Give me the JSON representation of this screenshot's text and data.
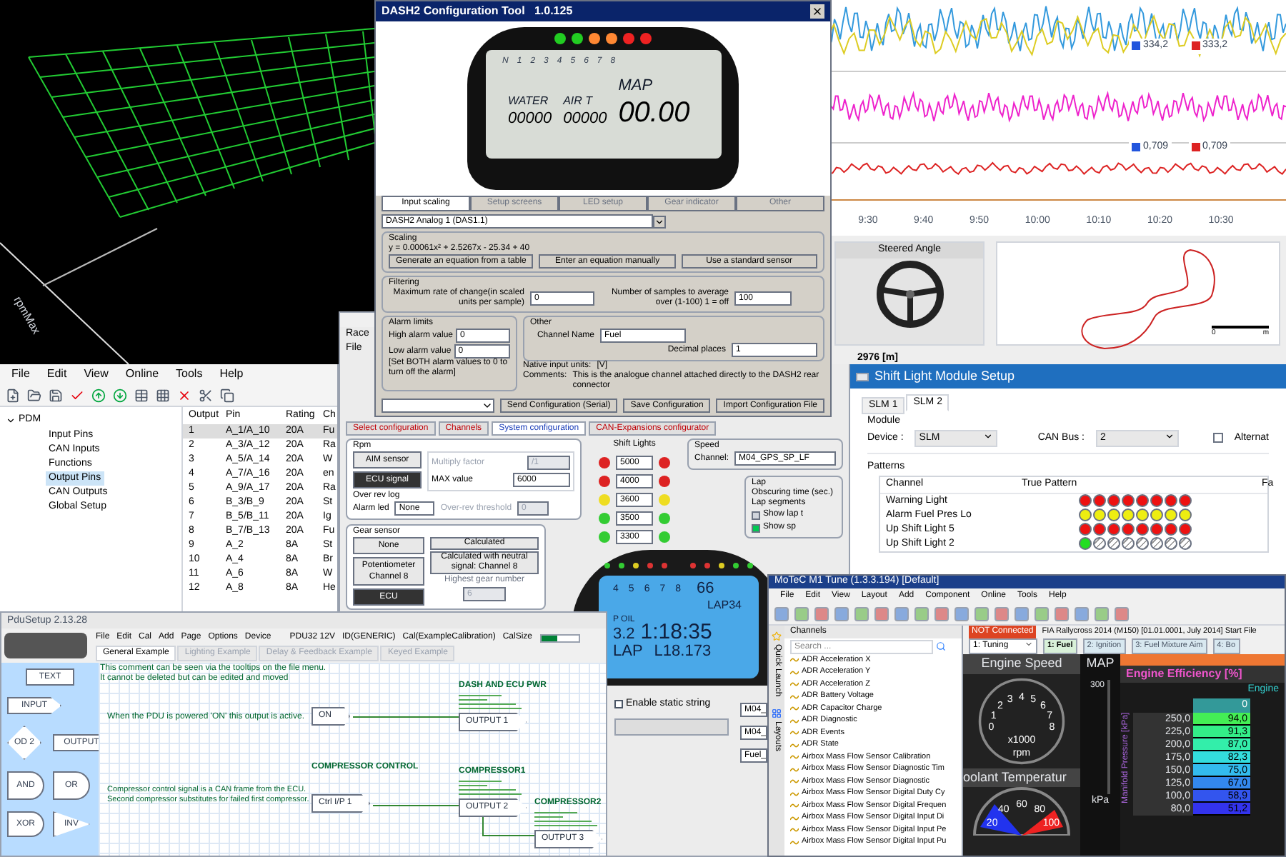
{
  "mesh_view": {
    "axis_label": "rpmMax"
  },
  "time_graph": {
    "markers": [
      {
        "value": "334,2",
        "color": "#2255dd"
      },
      {
        "value": "333,2",
        "color": "#dd2222"
      },
      {
        "value": "0,709",
        "color": "#2255dd"
      },
      {
        "value": "0,709",
        "color": "#dd2222"
      }
    ],
    "time_labels": [
      "9:30",
      "9:40",
      "9:50",
      "10:00",
      "10:10",
      "10:20",
      "10:30"
    ]
  },
  "dash_tool": {
    "title": "DASH2 Configuration Tool   1.0.125",
    "shift_lights": [
      {
        "color": "#22cc22"
      },
      {
        "color": "#22cc22"
      },
      {
        "color": "#ff8833"
      },
      {
        "color": "#ff8833"
      },
      {
        "color": "#ee2222"
      },
      {
        "color": "#ee2222"
      }
    ],
    "display": {
      "rpm_scale": [
        "N",
        "1",
        "2",
        "3",
        "4",
        "5",
        "6",
        "7",
        "8"
      ],
      "fields": [
        {
          "label": "WATER",
          "value": "00000"
        },
        {
          "label": "AIR T",
          "value": "00000"
        },
        {
          "label": "MAP",
          "value": "00.00"
        }
      ]
    },
    "tabs": [
      {
        "label": "Input scaling",
        "selected": true
      },
      {
        "label": "Setup screens",
        "selected": false
      },
      {
        "label": "LED setup",
        "selected": false
      },
      {
        "label": "Gear indicator",
        "selected": false
      },
      {
        "label": "Other",
        "selected": false
      }
    ],
    "channel_select": "DASH2 Analog 1 (DAS1.1)",
    "scaling": {
      "title": "Scaling",
      "equation": "y = 0.00061x² + 2.5267x - 25.34 + 40",
      "buttons": [
        "Generate an equation from a table",
        "Enter an equation manually",
        "Use a standard sensor"
      ]
    },
    "filtering": {
      "title": "Filtering",
      "max_rate_label": "Maximum rate of change(in scaled units per sample)",
      "max_rate": "0",
      "samples_label": "Number of samples to average over (1-100) 1 = off",
      "samples": "100"
    },
    "alarm": {
      "title": "Alarm limits",
      "high_label": "High alarm value",
      "high": "0",
      "low_label": "Low alarm value",
      "low": "0",
      "note": "[Set BOTH alarm values to 0 to turn off the alarm]"
    },
    "other": {
      "title": "Other",
      "name_label": "Channel Name",
      "name": "Fuel",
      "decimals_label": "Decimal places",
      "decimals": "1",
      "units_label": "Native input units:",
      "units": "[V]",
      "comments_label": "Comments:",
      "comments": "This is the analogue channel attached directly to the DASH2 rear connector"
    },
    "footer_buttons": [
      "Send Configuration (Serial)",
      "Save Configuration",
      "Import Configuration File"
    ]
  },
  "steering": {
    "gauge_title": "Steered Angle",
    "scale": [
      "0",
      "m"
    ],
    "distance": "2976 [m]"
  },
  "pdm": {
    "menu": [
      "File",
      "Edit",
      "View",
      "Online",
      "Tools",
      "Help"
    ],
    "tree": {
      "label": "PDM",
      "expanded": true,
      "children": [
        {
          "label": "Input Pins",
          "selected": false
        },
        {
          "label": "CAN Inputs",
          "selected": false
        },
        {
          "label": "Functions",
          "selected": false
        },
        {
          "label": "Output Pins",
          "selected": true
        },
        {
          "label": "CAN Outputs",
          "selected": false
        },
        {
          "label": "Global Setup",
          "selected": false
        }
      ]
    },
    "table": {
      "columns": [
        "Output",
        "Pin",
        "Rating",
        "Ch"
      ],
      "rows": [
        {
          "cells": [
            "1",
            "A_1/A_10",
            "20A",
            "Fu"
          ],
          "selected": true
        },
        {
          "cells": [
            "2",
            "A_3/A_12",
            "20A",
            "Ra"
          ],
          "selected": false
        },
        {
          "cells": [
            "3",
            "A_5/A_14",
            "20A",
            "W"
          ],
          "selected": false
        },
        {
          "cells": [
            "4",
            "A_7/A_16",
            "20A",
            "en"
          ],
          "selected": false
        },
        {
          "cells": [
            "5",
            "A_9/A_17",
            "20A",
            "Ra"
          ],
          "selected": false
        },
        {
          "cells": [
            "6",
            "B_3/B_9",
            "20A",
            "St"
          ],
          "selected": false
        },
        {
          "cells": [
            "7",
            "B_5/B_11",
            "20A",
            "Ig"
          ],
          "selected": false
        },
        {
          "cells": [
            "8",
            "B_7/B_13",
            "20A",
            "Fu"
          ],
          "selected": false
        },
        {
          "cells": [
            "9",
            "A_2",
            "8A",
            "St"
          ],
          "selected": false
        },
        {
          "cells": [
            "10",
            "A_4",
            "8A",
            "Br"
          ],
          "selected": false
        },
        {
          "cells": [
            "11",
            "A_6",
            "8A",
            "W"
          ],
          "selected": false
        },
        {
          "cells": [
            "12",
            "A_8",
            "8A",
            "He"
          ],
          "selected": false
        }
      ]
    }
  },
  "race_studio": {
    "title": "Race",
    "menu": [
      "File"
    ],
    "tabs": [
      {
        "label": "Select configuration",
        "selected": false
      },
      {
        "label": "Channels",
        "selected": false
      },
      {
        "label": "System configuration",
        "selected": true
      },
      {
        "label": "CAN-Expansions configurator",
        "selected": false
      }
    ],
    "rpm": {
      "title": "Rpm",
      "sources": [
        {
          "label": "AIM sensor",
          "selected": false
        },
        {
          "label": "ECU signal",
          "selected": true
        }
      ],
      "multiply_label": "Multiply factor",
      "multiply": "/1",
      "max_label": "MAX value",
      "max": "6000",
      "over_rev_title": "Over rev log",
      "alarm_led_label": "Alarm led",
      "alarm_led": "None",
      "threshold_label": "Over-rev threshold",
      "threshold": "0"
    },
    "gear": {
      "title": "Gear sensor",
      "sources": [
        {
          "label": "None",
          "selected": false
        },
        {
          "label": "Potentiometer Channel 8",
          "selected": false
        },
        {
          "label": "ECU",
          "selected": true
        }
      ],
      "calc_buttons": [
        "Calculated",
        "Calculated with neutral signal: Channel 8"
      ],
      "highest_label": "Highest gear number",
      "highest": "6"
    },
    "shift_lights": {
      "title": "Shift Lights",
      "rows": [
        {
          "value": "5000",
          "color": "#dd2222"
        },
        {
          "value": "4000",
          "color": "#dd2222"
        },
        {
          "value": "3600",
          "color": "#eedd22"
        },
        {
          "value": "3500",
          "color": "#33cc33"
        },
        {
          "value": "3300",
          "color": "#33cc33"
        }
      ]
    },
    "speed": {
      "title": "Speed",
      "channel_label": "Channel:",
      "channel": "M04_GPS_SP_LF"
    },
    "lap": {
      "title": "Lap",
      "obscuring_label": "Obscuring time (sec.)",
      "segments_label": "Lap segments",
      "options": [
        {
          "label": "Show lap t",
          "checked": false
        },
        {
          "label": "Show sp",
          "checked": true
        }
      ]
    },
    "display": {
      "rpm_scale": [
        "4",
        "5",
        "6",
        "7",
        "8"
      ],
      "speed": "66",
      "lap_count": "LAP34",
      "oil_label": "P OIL",
      "oil": "3.2",
      "lap_time": "1:18:35",
      "mode": "LAP",
      "best": "L18.173"
    },
    "static_string": {
      "label": "Enable static string",
      "checked": false
    },
    "fields": [
      "M04_",
      "M04_",
      "Fuel_"
    ]
  },
  "shift_module": {
    "title": "Shift Light Module Setup",
    "tabs": [
      {
        "label": "SLM 1",
        "selected": false
      },
      {
        "label": "SLM 2",
        "selected": true
      }
    ],
    "module": {
      "title": "Module",
      "device_label": "Device :",
      "device": "SLM",
      "bus_label": "CAN Bus :",
      "bus": "2",
      "alternate": {
        "label": "Alternat",
        "checked": false
      }
    },
    "patterns": {
      "title": "Patterns",
      "columns": [
        "Channel",
        "True Pattern",
        "Fa"
      ],
      "rows": [
        {
          "channel": "Warning Light",
          "lights": [
            {
              "on": true,
              "color": "#ee1111"
            },
            {
              "on": true,
              "color": "#ee1111"
            },
            {
              "on": true,
              "color": "#ee1111"
            },
            {
              "on": true,
              "color": "#ee1111"
            },
            {
              "on": true,
              "color": "#ee1111"
            },
            {
              "on": true,
              "color": "#ee1111"
            },
            {
              "on": true,
              "color": "#ee1111"
            },
            {
              "on": true,
              "color": "#ee1111"
            }
          ]
        },
        {
          "channel": "Alarm Fuel Pres Lo",
          "lights": [
            {
              "on": true,
              "color": "#eeee11"
            },
            {
              "on": true,
              "color": "#eeee11"
            },
            {
              "on": true,
              "color": "#eeee11"
            },
            {
              "on": true,
              "color": "#eeee11"
            },
            {
              "on": true,
              "color": "#eeee11"
            },
            {
              "on": true,
              "color": "#eeee11"
            },
            {
              "on": true,
              "color": "#eeee11"
            },
            {
              "on": true,
              "color": "#eeee11"
            }
          ]
        },
        {
          "channel": "Up Shift Light 5",
          "lights": [
            {
              "on": true,
              "color": "#ee1111"
            },
            {
              "on": true,
              "color": "#ee1111"
            },
            {
              "on": true,
              "color": "#ee1111"
            },
            {
              "on": true,
              "color": "#ee1111"
            },
            {
              "on": true,
              "color": "#ee1111"
            },
            {
              "on": true,
              "color": "#ee1111"
            },
            {
              "on": true,
              "color": "#ee1111"
            },
            {
              "on": true,
              "color": "#ee1111"
            }
          ]
        },
        {
          "channel": "Up Shift Light 2",
          "lights": [
            {
              "on": true,
              "color": "#22dd22"
            },
            {
              "on": false
            },
            {
              "on": false
            },
            {
              "on": false
            },
            {
              "on": false
            },
            {
              "on": false
            },
            {
              "on": false
            },
            {
              "on": false
            }
          ]
        }
      ]
    }
  },
  "pdu_setup": {
    "title": "PduSetup 2.13.28",
    "menu": [
      "File",
      "Edit",
      "Cal",
      "Add",
      "Page",
      "Options",
      "Device"
    ],
    "status": [
      "PDU32 12V",
      "ID(GENERIC)",
      "Cal(ExampleCalibration)",
      "CalSize"
    ],
    "cal_bar": {
      "level": 0.45
    },
    "tabs": [
      {
        "label": "General Example",
        "selected": true
      },
      {
        "label": "Lighting Example",
        "selected": false
      },
      {
        "label": "Delay & Feedback Example",
        "selected": false
      },
      {
        "label": "Keyed Example",
        "selected": false
      }
    ],
    "palette": [
      {
        "kind": "text",
        "label": "TEXT"
      },
      {
        "kind": "input",
        "label": "INPUT"
      },
      {
        "kind": "diamond",
        "label": "OD 2"
      },
      {
        "kind": "output",
        "label": "OUTPUT"
      },
      {
        "kind": "and",
        "label": "AND"
      },
      {
        "kind": "or",
        "label": "OR"
      },
      {
        "kind": "xor",
        "label": "XOR"
      },
      {
        "kind": "inv",
        "label": "INV"
      }
    ],
    "comments": [
      "This comment can be seen via the tooltips on the file menu.",
      "It cannot be deleted but can be edited and moved",
      "When the PDU is powered 'ON' this output is active.",
      "Compressor control signal is a CAN frame from the ECU.",
      "Second compressor substitutes for failed first compressor."
    ],
    "inputs": [
      {
        "label": "ON"
      },
      {
        "heading": "COMPRESSOR CONTROL",
        "label": "Ctrl I/P 1"
      }
    ],
    "outputs": [
      {
        "heading": "DASH AND ECU PWR",
        "label": "OUTPUT 1"
      },
      {
        "heading": "COMPRESSOR1",
        "label": "OUTPUT 2"
      },
      {
        "heading": "COMPRESSOR2",
        "label": "OUTPUT 3"
      }
    ]
  },
  "m1_tune": {
    "title": "MoTeC M1 Tune (1.3.3.194) [Default]",
    "menu": [
      "File",
      "Edit",
      "View",
      "Layout",
      "Add",
      "Component",
      "Online",
      "Tools",
      "Help"
    ],
    "side_tabs": [
      "Quick Launch",
      "Layouts"
    ],
    "channels": {
      "title": "Channels",
      "placeholder": "Search ...",
      "items": [
        "ADR Acceleration X",
        "ADR Acceleration Y",
        "ADR Acceleration Z",
        "ADR Battery Voltage",
        "ADR Capacitor Charge",
        "ADR Diagnostic",
        "ADR Events",
        "ADR State",
        "Airbox Mass Flow Sensor Calibration",
        "Airbox Mass Flow Sensor Diagnostic Tim",
        "Airbox Mass Flow Sensor Diagnostic",
        "Airbox Mass Flow Sensor Digital Duty Cy",
        "Airbox Mass Flow Sensor Digital Frequen",
        "Airbox Mass Flow Sensor Digital Input Di",
        "Airbox Mass Flow Sensor Digital Input Pe",
        "Airbox Mass Flow Sensor Digital Input Pu"
      ]
    },
    "connection": "NOT Connected",
    "file_info": "FIA Rallycross 2014 (M150) [01.01.0001, July 2014] Start File",
    "workbook": "1: Tuning",
    "tabs": [
      {
        "label": "1: Fuel",
        "selected": true
      },
      {
        "label": "2: Ignition",
        "selected": false
      },
      {
        "label": "3: Fuel Mixture Aim",
        "selected": false
      },
      {
        "label": "4: Bo",
        "selected": false
      }
    ],
    "engine_speed": {
      "title": "Engine Speed",
      "scale": [
        "0",
        "1",
        "2",
        "3",
        "4",
        "5",
        "6",
        "7",
        "8"
      ],
      "multiplier": "x1000",
      "unit": "rpm"
    },
    "coolant": {
      "title": "oolant Temperatur",
      "scale": [
        "20",
        "40",
        "60",
        "80",
        "100"
      ]
    },
    "map": {
      "title": "MAP",
      "max": "300",
      "unit": "kPa"
    },
    "efficiency": {
      "title": "Engine Efficiency [%]",
      "column_title": "Engine",
      "column": "0",
      "axis_label": "Manifold Pressure [kPa]",
      "rows": [
        {
          "label": "250,0",
          "value": "94,0",
          "color": "#44ee55"
        },
        {
          "label": "225,0",
          "value": "91,3",
          "color": "#33ee88"
        },
        {
          "label": "200,0",
          "value": "87,0",
          "color": "#33eeaa"
        },
        {
          "label": "175,0",
          "value": "82,3",
          "color": "#33dddd"
        },
        {
          "label": "150,0",
          "value": "75,0",
          "color": "#33bbee"
        },
        {
          "label": "125,0",
          "value": "67,0",
          "color": "#3388ee"
        },
        {
          "label": "100,0",
          "value": "58,9",
          "color": "#3355ee"
        },
        {
          "label": "80,0",
          "value": "51,2",
          "color": "#3333ee"
        }
      ]
    }
  }
}
